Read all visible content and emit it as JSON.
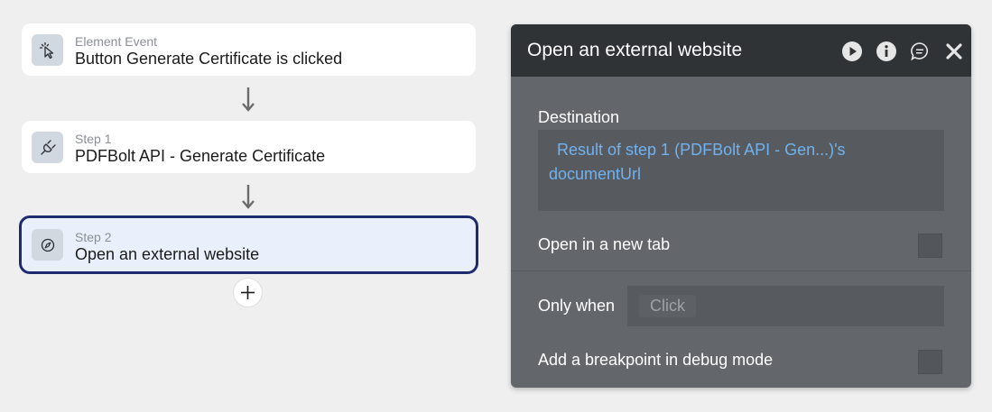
{
  "workflow": {
    "event": {
      "subtitle": "Element Event",
      "title": "Button Generate Certificate is clicked",
      "icon": "cursor-click-icon"
    },
    "step1": {
      "subtitle": "Step 1",
      "title": "PDFBolt API - Generate Certificate",
      "icon": "plug-icon"
    },
    "step2": {
      "subtitle": "Step 2",
      "title": "Open an external website",
      "icon": "compass-icon"
    },
    "add_icon": "plus-icon"
  },
  "panel": {
    "title": "Open an external website",
    "header_icons": [
      "play-icon",
      "info-icon",
      "comment-icon",
      "close-icon"
    ],
    "destination_label": "Destination",
    "destination_line1": "Result of step 1 (PDFBolt API - Gen...)'s",
    "destination_line2": "documentUrl",
    "new_tab_label": "Open in a new tab",
    "only_when_label": "Only when",
    "only_when_placeholder": "Click",
    "breakpoint_label": "Add a breakpoint in debug mode"
  },
  "colors": {
    "selected_border": "#1e2c6f",
    "selected_bg": "#eaf0fb",
    "panel_bg": "#63676b",
    "panel_header_bg": "#2f3335",
    "expression_text": "#6fb2f0"
  }
}
